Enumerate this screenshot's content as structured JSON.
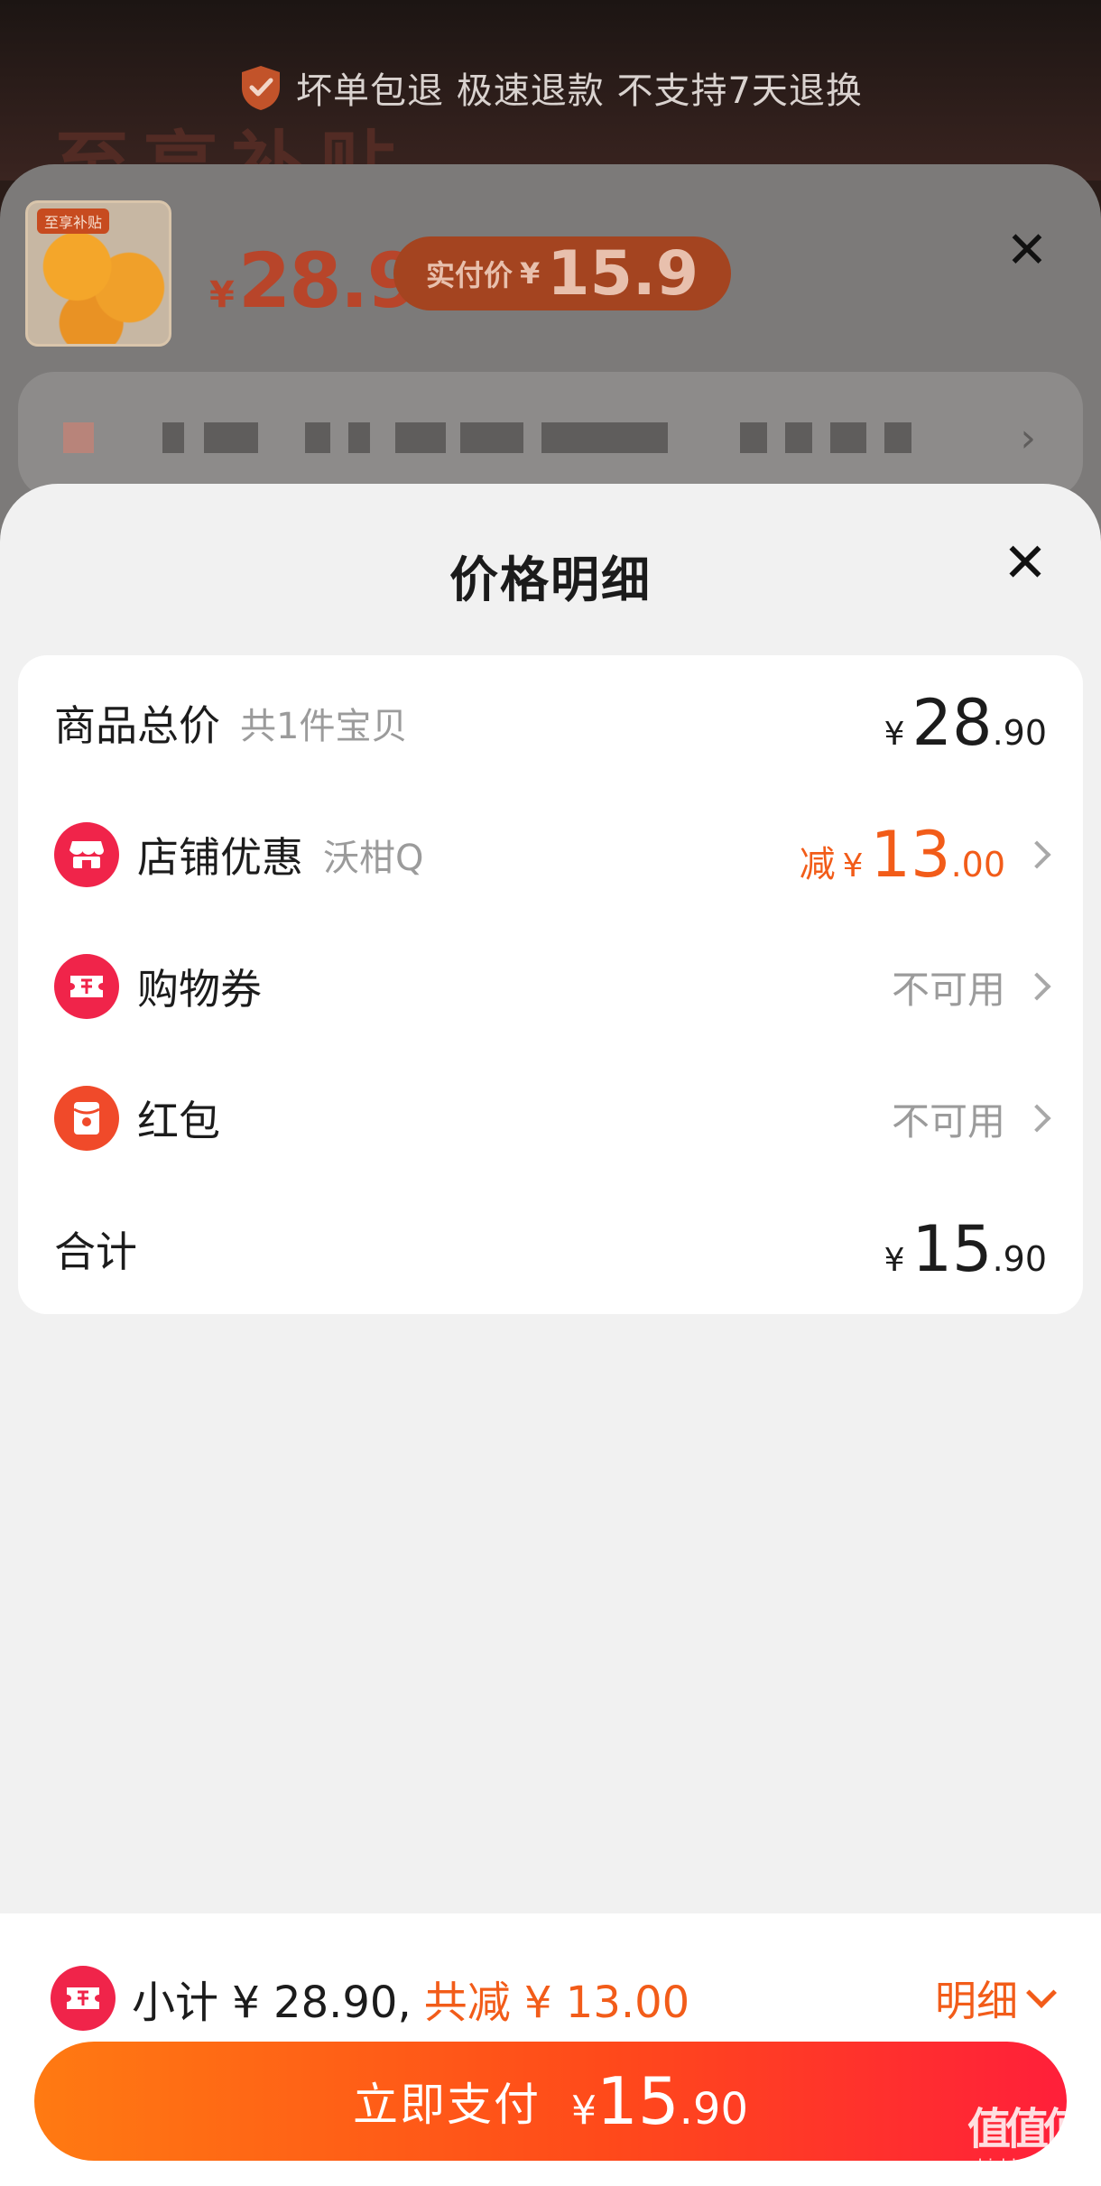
{
  "header": {
    "guarantee_text": "坏单包退 极速退款 不支持7天退换",
    "banner_ghost": "至享补贴"
  },
  "product": {
    "thumb_tag": "至享补贴",
    "price_yen": "¥",
    "price": "28.9",
    "paid_label": "实付价",
    "paid_yen": "¥",
    "paid_price": "15.9"
  },
  "panel": {
    "title": "价格明细",
    "rows": [
      {
        "label": "商品总价",
        "sub": "共1件宝贝",
        "yen": "¥",
        "int": "28",
        "dec": ".90"
      },
      {
        "icon": "store-icon",
        "label": "店铺优惠",
        "sub": "沃柑Q",
        "prefix": "减",
        "yen": "¥",
        "int": "13",
        "dec": ".00"
      },
      {
        "icon": "coupon-icon",
        "label": "购物券",
        "value": "不可用"
      },
      {
        "icon": "red-packet-icon",
        "label": "红包",
        "value": "不可用"
      },
      {
        "label": "合计",
        "yen": "¥",
        "int": "15",
        "dec": ".90"
      }
    ]
  },
  "bottom": {
    "subtotal": "小计 ¥ 28.90,",
    "saving": "共减 ¥ 13.00",
    "detail_link": "明细",
    "pay_label": "立即支付",
    "pay_yen": "¥",
    "pay_int": "15",
    "pay_dec": ".90"
  },
  "watermark": {
    "mark": "值值值",
    "url": "zhizhizhi.com"
  },
  "colors": {
    "accent_orange": "#f25c19",
    "accent_red": "#f0244a",
    "muted": "#9b9b9b"
  }
}
